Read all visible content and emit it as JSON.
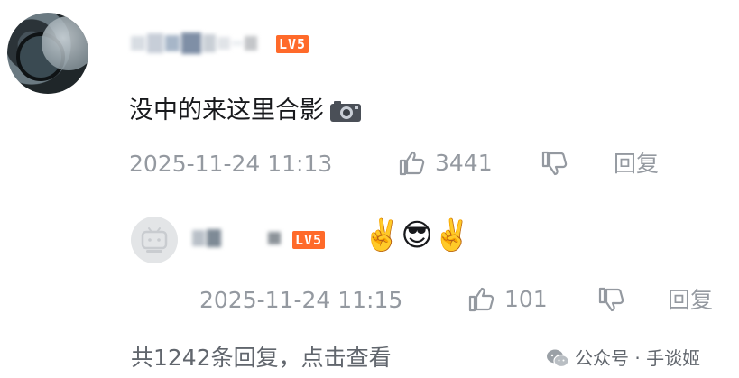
{
  "comment": {
    "level_badge": "LV5",
    "text": "没中的来这里合影",
    "timestamp": "2025-11-24 11:13",
    "like_count": "3441",
    "reply_label": "回复",
    "icons": {
      "camera": "camera-icon",
      "like": "thumbs-up-icon",
      "dislike": "thumbs-down-icon"
    }
  },
  "reply": {
    "level_badge": "LV5",
    "emojis": "✌️😎✌️",
    "timestamp": "2025-11-24 11:15",
    "like_count": "101",
    "reply_label": "回复"
  },
  "footer": {
    "view_replies": "共1242条回复，点击查看",
    "watermark": "公众号 · 手谈姬"
  },
  "colors": {
    "accent": "#ff6a2a",
    "meta_text": "#9499a0",
    "primary_text": "#18191c"
  }
}
